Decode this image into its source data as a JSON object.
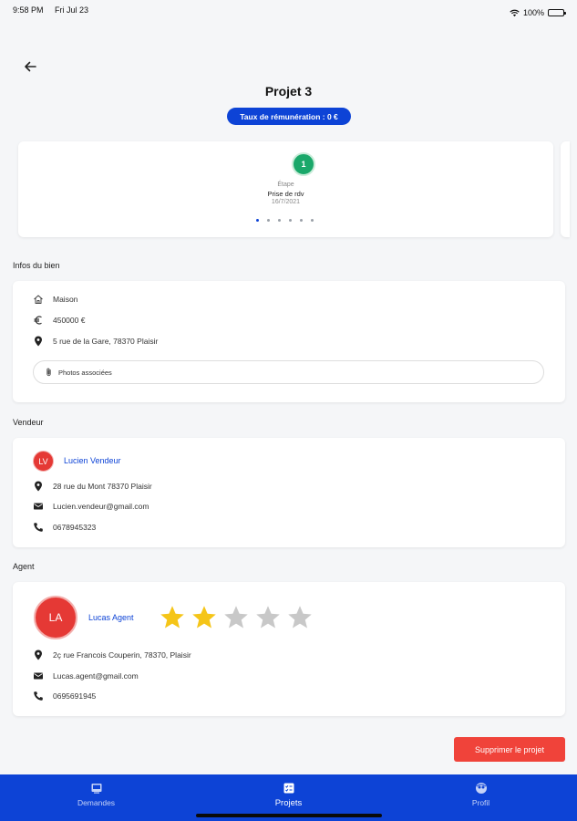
{
  "status_bar": {
    "time": "9:58 PM",
    "date": "Fri Jul 23",
    "battery": "100%",
    "battery_level": 1.0
  },
  "header": {
    "title": "Projet 3",
    "rate_badge": "Taux de rémunération : 0 €"
  },
  "stepper": {
    "step_number": "1",
    "caption": "Étape",
    "name": "Prise de rdv",
    "date": "16/7/2021",
    "page_count": 6,
    "active_page": 1
  },
  "bien": {
    "section_label": "Infos du bien",
    "type": "Maison",
    "price": "450000 €",
    "address": "5 rue de la Gare, 78370 Plaisir",
    "photos_button": "Photos associées"
  },
  "vendeur": {
    "section_label": "Vendeur",
    "initials": "LV",
    "name": "Lucien Vendeur",
    "address": "28 rue du Mont 78370 Plaisir",
    "email": "Lucien.vendeur@gmail.com",
    "phone": "0678945323"
  },
  "agent": {
    "section_label": "Agent",
    "initials": "LA",
    "name": "Lucas Agent",
    "rating": 2,
    "rating_max": 5,
    "address": "2ç rue Francois Couperin, 78370, Plaisir",
    "email": "Lucas.agent@gmail.com",
    "phone": "0695691945"
  },
  "actions": {
    "delete_label": "Supprimer le projet"
  },
  "tabbar": {
    "tabs": [
      {
        "label": "Demandes",
        "icon": "inbox-icon"
      },
      {
        "label": "Projets",
        "icon": "projects-icon"
      },
      {
        "label": "Profil",
        "icon": "profile-icon"
      }
    ],
    "active_index": 1
  },
  "colors": {
    "primary": "#0d43d6",
    "success": "#1aa86a",
    "danger": "#f0433a",
    "avatar": "#e53935",
    "star_filled": "#f5c518",
    "star_empty": "#c8c8c8"
  }
}
